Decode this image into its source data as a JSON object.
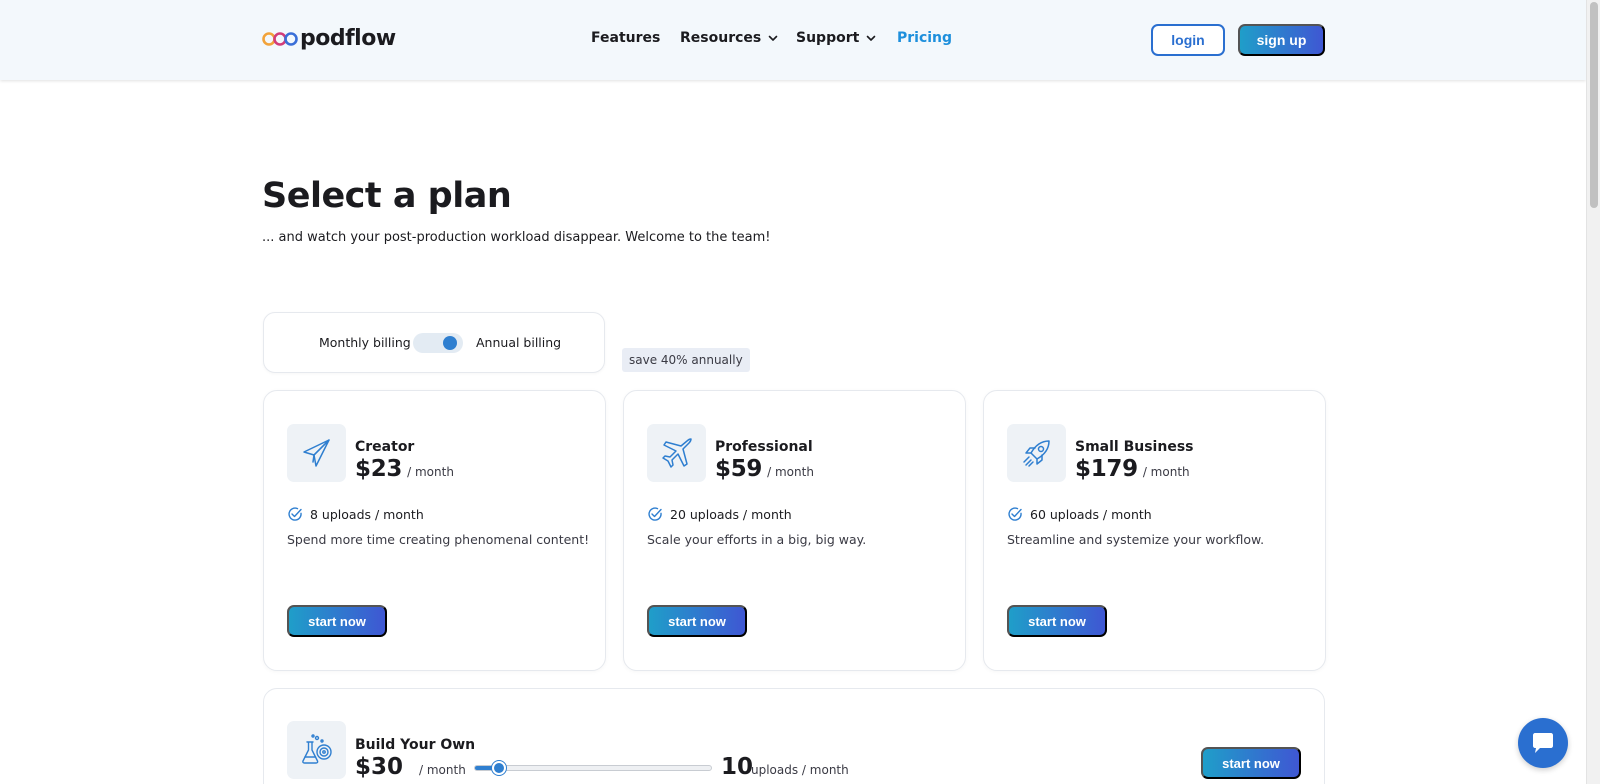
{
  "brand": {
    "name": "podflow",
    "accent": "#1d8fdc",
    "button_gradient": [
      "#1f9ec9",
      "#3f57d3"
    ]
  },
  "nav": {
    "items": [
      {
        "label": "Features",
        "has_dropdown": false,
        "active": false
      },
      {
        "label": "Resources",
        "has_dropdown": true,
        "active": false
      },
      {
        "label": "Support",
        "has_dropdown": true,
        "active": false
      },
      {
        "label": "Pricing",
        "has_dropdown": false,
        "active": true
      }
    ],
    "login_label": "login",
    "signup_label": "sign up"
  },
  "hero": {
    "title": "Select a plan",
    "subtitle": "... and watch your post-production workload disappear. Welcome to the team!"
  },
  "billing": {
    "monthly_label": "Monthly billing",
    "annual_label": "Annual billing",
    "selected": "annual",
    "save_badge": "save 40% annually"
  },
  "plans": [
    {
      "name": "Creator",
      "icon": "paper-plane-icon",
      "price": "$23",
      "period": "/ month",
      "feature": "8 uploads / month",
      "description": "Spend more time creating phenomenal content!",
      "cta": "start now"
    },
    {
      "name": "Professional",
      "icon": "airplane-icon",
      "price": "$59",
      "period": "/ month",
      "feature": "20 uploads / month",
      "description": "Scale your efforts in a big, big way.",
      "cta": "start now"
    },
    {
      "name": "Small Business",
      "icon": "rocket-icon",
      "price": "$179",
      "period": "/ month",
      "feature": "60 uploads / month",
      "description": "Streamline and systemize your workflow.",
      "cta": "start now"
    }
  ],
  "custom_plan": {
    "name": "Build Your Own",
    "icon": "lab-flask-icon",
    "price": "$30",
    "period": "/ month",
    "uploads": "10",
    "uploads_label": "uploads / month",
    "slider_fraction": 0.1,
    "cta": "start now"
  },
  "chat": {
    "icon": "chat-bubble-icon"
  }
}
